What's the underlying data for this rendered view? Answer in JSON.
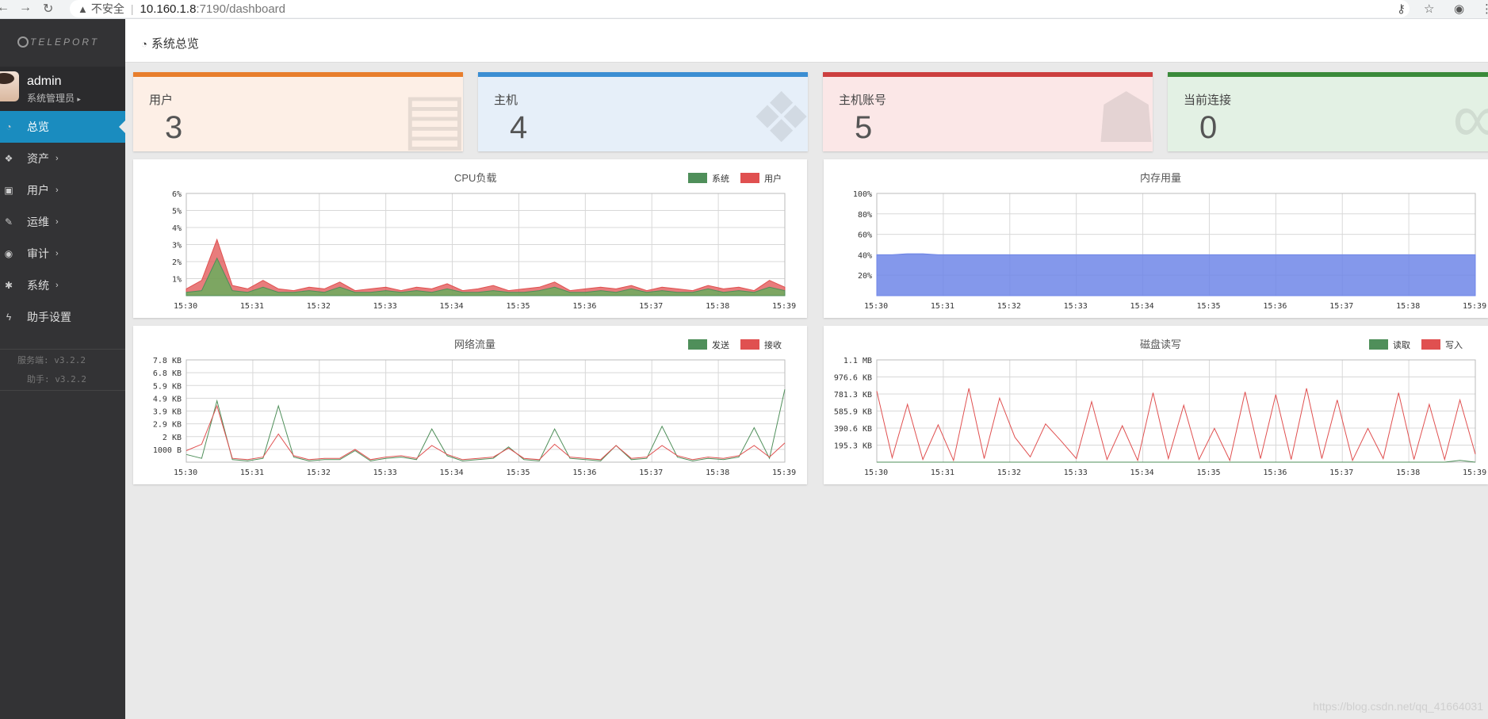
{
  "browser": {
    "not_secure": "不安全",
    "host": "10.160.1.8",
    "path": ":7190/dashboard"
  },
  "sidebar": {
    "logo": "TELEPORT",
    "user": {
      "name": "admin",
      "role": "系统管理员"
    },
    "items": [
      {
        "label": "总览",
        "icon": "dashboard-icon",
        "active": true,
        "has_children": false
      },
      {
        "label": "资产",
        "icon": "cubes-icon",
        "active": false,
        "has_children": true
      },
      {
        "label": "用户",
        "icon": "address-card-icon",
        "active": false,
        "has_children": true
      },
      {
        "label": "运维",
        "icon": "wrench-icon",
        "active": false,
        "has_children": true
      },
      {
        "label": "审计",
        "icon": "eye-icon",
        "active": false,
        "has_children": true
      },
      {
        "label": "系统",
        "icon": "cog-icon",
        "active": false,
        "has_children": true
      },
      {
        "label": "助手设置",
        "icon": "bolt-icon",
        "active": false,
        "has_children": false
      }
    ],
    "server_version": "服务端: v3.2.2",
    "assist_version": "助手: v3.2.2"
  },
  "header": {
    "title": "系统总览"
  },
  "stats": [
    {
      "label": "用户",
      "value": "3",
      "color": "#e87e2c",
      "bg": "#fdefe6",
      "icon": "id-card-icon"
    },
    {
      "label": "主机",
      "value": "4",
      "color": "#3b8ed3",
      "bg": "#e6eff9",
      "icon": "cubes-icon"
    },
    {
      "label": "主机账号",
      "value": "5",
      "color": "#cc3f3f",
      "bg": "#fbe7e7",
      "icon": "user-secret-icon"
    },
    {
      "label": "当前连接",
      "value": "0",
      "color": "#3a8a3a",
      "bg": "#e3f1e4",
      "icon": "link-icon"
    }
  ],
  "chart_data": [
    {
      "type": "area",
      "title": "CPU负载",
      "x": [
        "15:30",
        "15:31",
        "15:32",
        "15:33",
        "15:34",
        "15:35",
        "15:36",
        "15:37",
        "15:38",
        "15:39"
      ],
      "y_ticks": [
        "1%",
        "2%",
        "3%",
        "4%",
        "5%",
        "6%"
      ],
      "ylim": [
        0,
        6
      ],
      "legend": [
        {
          "name": "系统",
          "color": "#4f8f5a"
        },
        {
          "name": "用户",
          "color": "#e05050"
        }
      ],
      "series": [
        {
          "name": "系统",
          "values": [
            0.2,
            0.3,
            2.2,
            0.3,
            0.2,
            0.5,
            0.2,
            0.2,
            0.3,
            0.2,
            0.5,
            0.2,
            0.2,
            0.3,
            0.2,
            0.3,
            0.2,
            0.4,
            0.2,
            0.2,
            0.3,
            0.2,
            0.2,
            0.3,
            0.5,
            0.2,
            0.2,
            0.3,
            0.2,
            0.4,
            0.2,
            0.3,
            0.2,
            0.2,
            0.4,
            0.2,
            0.3,
            0.2,
            0.5,
            0.3
          ]
        },
        {
          "name": "用户",
          "values": [
            0.4,
            0.9,
            3.3,
            0.6,
            0.4,
            0.9,
            0.4,
            0.3,
            0.5,
            0.4,
            0.8,
            0.3,
            0.4,
            0.5,
            0.3,
            0.5,
            0.4,
            0.7,
            0.3,
            0.4,
            0.6,
            0.3,
            0.4,
            0.5,
            0.8,
            0.3,
            0.4,
            0.5,
            0.4,
            0.6,
            0.3,
            0.5,
            0.4,
            0.3,
            0.6,
            0.4,
            0.5,
            0.3,
            0.9,
            0.5
          ]
        }
      ]
    },
    {
      "type": "area",
      "title": "内存用量",
      "x": [
        "15:30",
        "15:31",
        "15:32",
        "15:33",
        "15:34",
        "15:35",
        "15:36",
        "15:37",
        "15:38",
        "15:39"
      ],
      "y_ticks": [
        "20%",
        "40%",
        "60%",
        "80%",
        "100%"
      ],
      "ylim": [
        0,
        100
      ],
      "series": [
        {
          "name": "内存",
          "values": [
            40,
            40,
            41,
            41,
            40,
            40,
            40,
            40,
            40,
            40,
            40,
            40,
            40,
            40,
            40,
            40,
            40,
            40,
            40,
            40,
            40,
            40,
            40,
            40,
            40,
            40,
            40,
            40,
            40,
            40,
            40,
            40,
            40,
            40,
            40,
            40,
            40,
            40,
            40,
            40
          ]
        }
      ]
    },
    {
      "type": "line",
      "title": "网络流量",
      "x": [
        "15:30",
        "15:31",
        "15:32",
        "15:33",
        "15:34",
        "15:35",
        "15:36",
        "15:37",
        "15:38",
        "15:39"
      ],
      "y_ticks": [
        "1000 B",
        "2 KB",
        "2.9 KB",
        "3.9 KB",
        "4.9 KB",
        "5.9 KB",
        "6.8 KB",
        "7.8 KB"
      ],
      "ylim": [
        0,
        8000
      ],
      "legend": [
        {
          "name": "发送",
          "color": "#4f8f5a"
        },
        {
          "name": "接收",
          "color": "#e05050"
        }
      ],
      "series": [
        {
          "name": "发送",
          "values": [
            600,
            300,
            4800,
            200,
            100,
            300,
            4400,
            400,
            100,
            200,
            200,
            900,
            100,
            300,
            400,
            200,
            2600,
            500,
            100,
            200,
            300,
            1200,
            200,
            100,
            2600,
            300,
            200,
            100,
            1300,
            200,
            300,
            2800,
            400,
            100,
            300,
            200,
            400,
            2700,
            300,
            5700
          ]
        },
        {
          "name": "接收",
          "values": [
            900,
            1400,
            4400,
            300,
            200,
            400,
            2200,
            500,
            200,
            300,
            300,
            1000,
            200,
            400,
            500,
            300,
            1300,
            600,
            200,
            300,
            400,
            1100,
            300,
            200,
            1400,
            400,
            300,
            200,
            1300,
            300,
            400,
            1300,
            500,
            200,
            400,
            300,
            500,
            1300,
            400,
            1500
          ]
        }
      ]
    },
    {
      "type": "line",
      "title": "磁盘读写",
      "x": [
        "15:30",
        "15:31",
        "15:32",
        "15:33",
        "15:34",
        "15:35",
        "15:36",
        "15:37",
        "15:38",
        "15:39"
      ],
      "y_ticks": [
        "195.3 KB",
        "390.6 KB",
        "585.9 KB",
        "781.3 KB",
        "976.6 KB",
        "1.1 MB"
      ],
      "ylim": [
        0,
        1150000
      ],
      "legend": [
        {
          "name": "读取",
          "color": "#4f8f5a"
        },
        {
          "name": "写入",
          "color": "#e05050"
        }
      ],
      "series": [
        {
          "name": "读取",
          "values": [
            0,
            0,
            0,
            0,
            0,
            0,
            0,
            0,
            0,
            0,
            0,
            0,
            0,
            0,
            0,
            0,
            0,
            0,
            0,
            0,
            0,
            0,
            0,
            0,
            0,
            0,
            0,
            0,
            0,
            0,
            0,
            0,
            0,
            0,
            0,
            0,
            0,
            0,
            20000,
            0
          ]
        },
        {
          "name": "写入",
          "values": [
            800000,
            50000,
            650000,
            30000,
            420000,
            20000,
            830000,
            40000,
            720000,
            280000,
            60000,
            430000,
            240000,
            40000,
            680000,
            30000,
            410000,
            20000,
            780000,
            40000,
            640000,
            30000,
            380000,
            20000,
            790000,
            40000,
            760000,
            30000,
            830000,
            40000,
            700000,
            20000,
            380000,
            40000,
            780000,
            30000,
            650000,
            30000,
            700000,
            90000
          ]
        }
      ]
    }
  ],
  "watermark": "https://blog.csdn.net/qq_41664031"
}
